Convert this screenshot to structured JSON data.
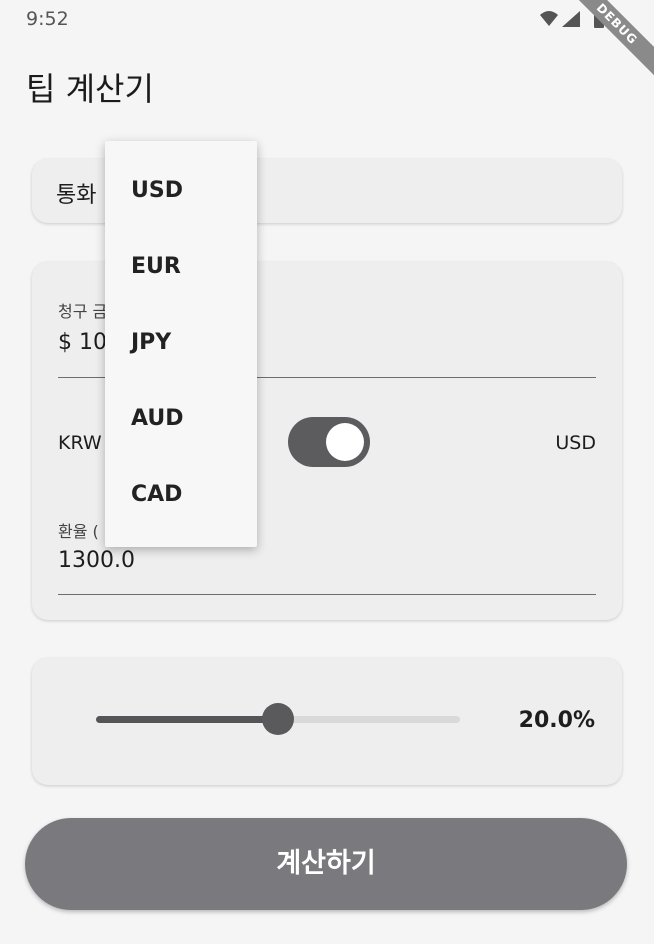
{
  "status_bar": {
    "time": "9:52",
    "icons": [
      "wifi-icon",
      "signal-icon",
      "battery-icon"
    ]
  },
  "debug_banner": "DEBUG",
  "app_title": "팁 계산기",
  "currency_card": {
    "label": "통화"
  },
  "bill_card": {
    "bill_label": "청구 금",
    "bill_value": "$ 10",
    "switch_left_label": "KRW",
    "switch_right_label": "USD",
    "switch_on": true,
    "rate_label": "환율 (",
    "rate_value": "1300.0"
  },
  "tip_card": {
    "slider_fraction": 0.5,
    "tip_value": "20.0%"
  },
  "calculate_button": "계산하기",
  "dropdown": {
    "items": [
      "USD",
      "EUR",
      "JPY",
      "AUD",
      "CAD"
    ]
  },
  "colors": {
    "background": "#f5f5f5",
    "card": "#eeeeef",
    "accent_dark": "#5c5c5f",
    "button": "#7a7a7e"
  }
}
